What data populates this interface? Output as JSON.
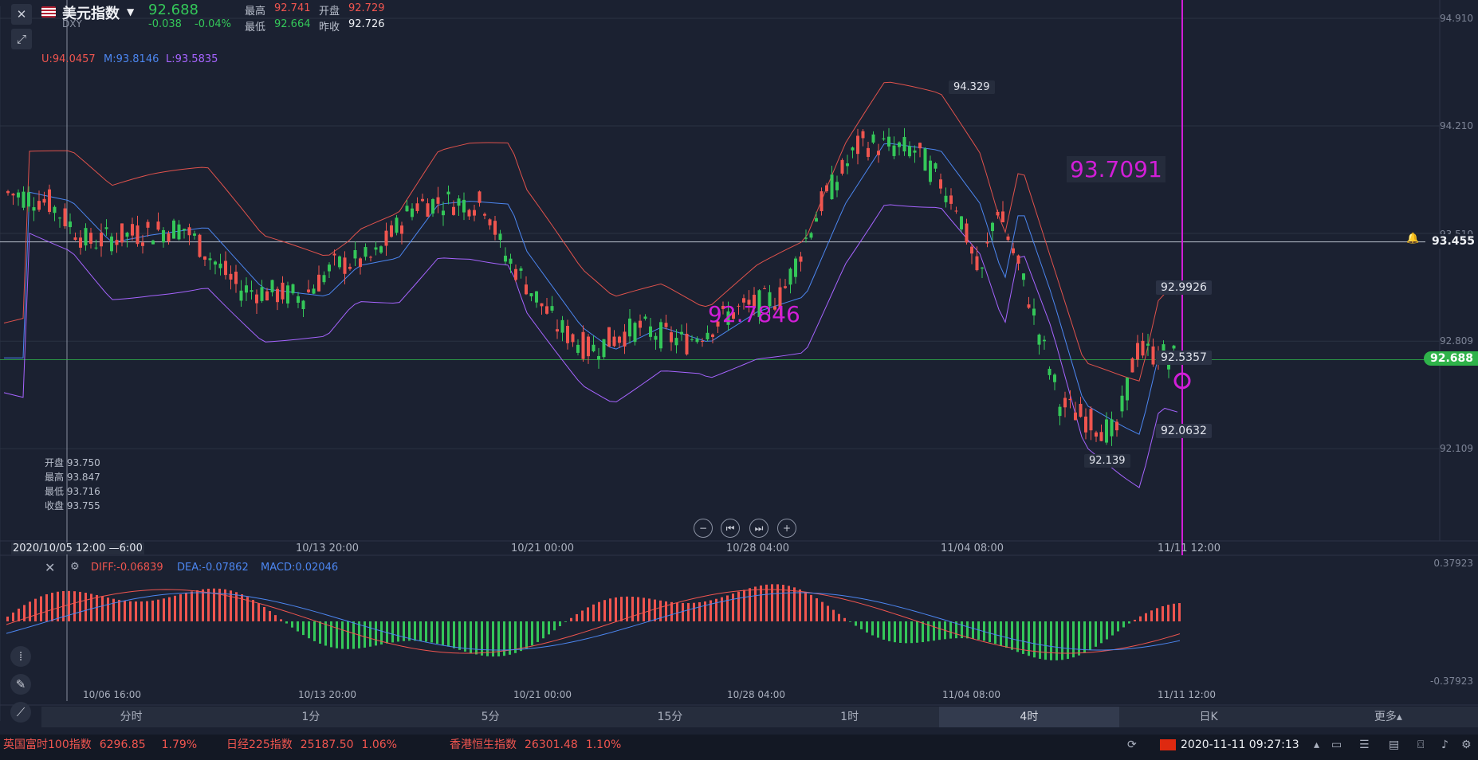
{
  "header": {
    "title": "美元指数",
    "symbol": "DXY",
    "price": "92.688",
    "change": "-0.038",
    "change_pct": "-0.04%",
    "high_label": "最高",
    "high": "92.741",
    "open_label": "开盘",
    "open": "92.729",
    "low_label": "最低",
    "low": "92.664",
    "prev_label": "昨收",
    "prev": "92.726"
  },
  "boll": {
    "upper": "U:94.0457",
    "mid": "M:93.8146",
    "lower": "L:93.5835"
  },
  "ohlc_panel": {
    "open": "开盘 93.750",
    "high": "最高 93.847",
    "low": "最低 93.716",
    "close": "收盘 93.755"
  },
  "price_axis": [
    "94.910",
    "94.210",
    "93.510",
    "92.809",
    "92.109"
  ],
  "price_axis_values": [
    94.91,
    94.21,
    93.51,
    92.809,
    92.109
  ],
  "crosshair_price": "93.455",
  "crosshair_price_value": 93.455,
  "last_price_tag": "92.688",
  "last_price_value": 92.688,
  "annotations": {
    "peak": "94.329",
    "trough": "92.139",
    "big_right": "93.7091",
    "big_mid": "92.7846",
    "upper_band": "92.9926",
    "mid_band": "92.5357",
    "lower_band": "92.0632"
  },
  "time_axis_main": [
    "2020/10/05 12:00 —6:00",
    "10/13 20:00",
    "10/21 00:00",
    "10/28 04:00",
    "11/04 08:00",
    "11/11 12:00"
  ],
  "macd": {
    "diff": "DIFF:-0.06839",
    "dea": "DEA:-0.07862",
    "macd": "MACD:0.02046",
    "axis_top": "0.37923",
    "axis_bottom": "-0.37923"
  },
  "time_axis_macd": [
    "10/06 16:00",
    "10/13 20:00",
    "10/21 00:00",
    "10/28 04:00",
    "11/04 08:00",
    "11/11 12:00"
  ],
  "tabs": [
    "分时",
    "1分",
    "5分",
    "15分",
    "1时",
    "4时",
    "日K",
    "更多▴"
  ],
  "active_tab": "4时",
  "ticker": [
    {
      "name": "英国富时100指数",
      "value": "6296.85",
      "pct": "1.79%"
    },
    {
      "name": "日经225指数",
      "value": "25187.50",
      "pct": "1.06%"
    },
    {
      "name": "香港恒生指数",
      "value": "26301.48",
      "pct": "1.10%"
    }
  ],
  "clock": "2020-11-11 09:27:13",
  "colors": {
    "up": "#f0554f",
    "down": "#34c759",
    "upper": "#e0524c",
    "mid": "#4c86f0",
    "lower": "#a664ff",
    "marker": "#d21ed8"
  },
  "icons": [
    "close-icon",
    "us-flag-icon",
    "pin-icon",
    "bell-icon",
    "settings-icon",
    "indicator-icon",
    "pencil-icon",
    "draw-tool-icon",
    "cn-flag-icon",
    "camera-icon",
    "volume-icon"
  ]
}
